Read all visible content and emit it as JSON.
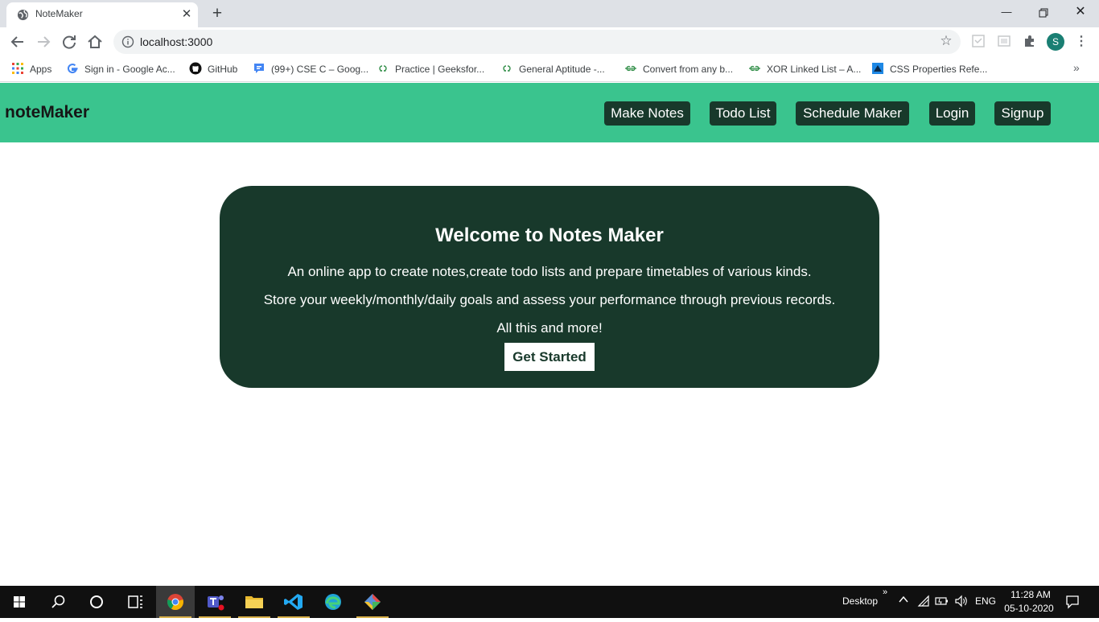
{
  "browser": {
    "tab_title": "NoteMaker",
    "url": "localhost:3000",
    "profile_initial": "S",
    "bookmarks": [
      {
        "label": "Apps",
        "icon": "apps-grid-icon"
      },
      {
        "label": "Sign in - Google Ac...",
        "icon": "google-icon"
      },
      {
        "label": "GitHub",
        "icon": "github-icon"
      },
      {
        "label": "(99+) CSE C – Goog...",
        "icon": "google-chat-icon"
      },
      {
        "label": "Practice | Geeksfor...",
        "icon": "gfg-icon"
      },
      {
        "label": "General Aptitude -...",
        "icon": "gfg-icon"
      },
      {
        "label": "Convert from any b...",
        "icon": "gfg-icon"
      },
      {
        "label": "XOR Linked List – A...",
        "icon": "gfg-icon"
      },
      {
        "label": "CSS Properties Refe...",
        "icon": "w3-icon"
      }
    ]
  },
  "navbar": {
    "brand": "noteMaker",
    "links": [
      "Make Notes",
      "Todo List",
      "Schedule Maker",
      "Login",
      "Signup"
    ]
  },
  "hero": {
    "title": "Welcome to Notes Maker",
    "line1": "An online app to create notes,create todo lists and prepare timetables of various kinds.",
    "line2": "Store your weekly/monthly/daily goals and assess your performance through previous records.",
    "line3": "All this and more!",
    "button": "Get Started"
  },
  "taskbar": {
    "tray_label": "Desktop",
    "language": "ENG",
    "time": "11:28 AM",
    "date": "05-10-2020"
  },
  "colors": {
    "navbar_bg": "#3ac48e",
    "dark_green": "#18392b"
  }
}
